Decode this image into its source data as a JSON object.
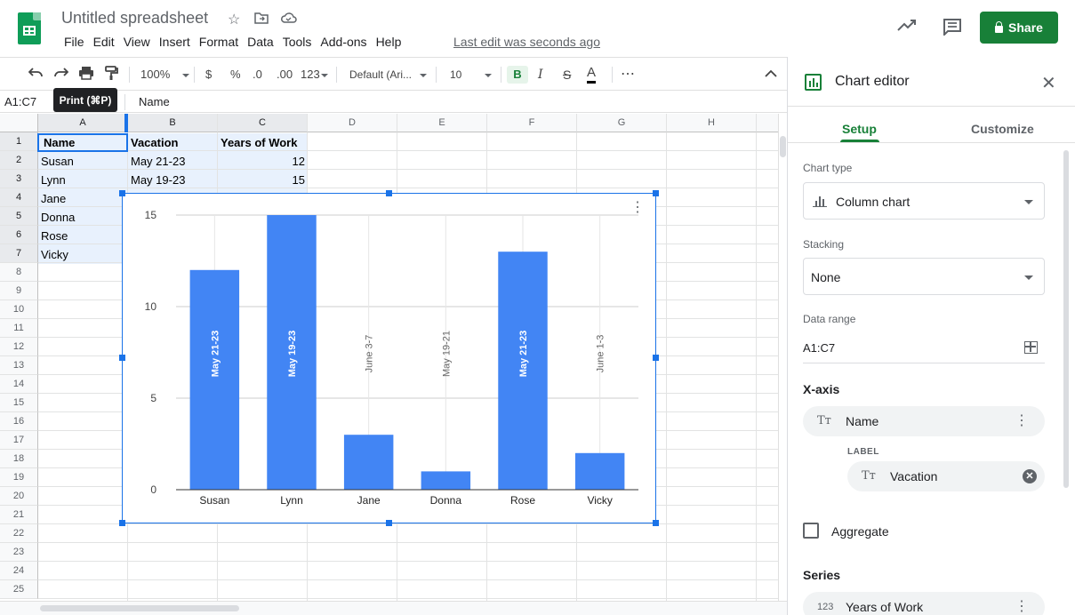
{
  "app": {
    "title": "Untitled spreadsheet",
    "menu": [
      "File",
      "Edit",
      "View",
      "Insert",
      "Format",
      "Data",
      "Tools",
      "Add-ons",
      "Help"
    ],
    "last_edit": "Last edit was seconds ago",
    "share_label": "Share",
    "accent_color": "#188038"
  },
  "toolbar": {
    "zoom": "100%",
    "currency": "$",
    "percent": "%",
    "dec_less": ".0",
    "dec_more": ".00",
    "format_more": "123",
    "font": "Default (Ari...",
    "font_size": "10",
    "bold": "B",
    "italic": "I",
    "strike": "S",
    "text_color": "A",
    "more": "⋯",
    "tooltip": "Print (⌘P)"
  },
  "formula": {
    "name_box": "A1:C7",
    "value": "Name"
  },
  "grid": {
    "columns": [
      "A",
      "B",
      "C",
      "D",
      "E",
      "F",
      "G",
      "H"
    ],
    "rows": [
      "1",
      "2",
      "3",
      "4",
      "5",
      "6",
      "7",
      "8",
      "9",
      "10",
      "11",
      "12",
      "13",
      "14",
      "15",
      "16",
      "17",
      "18",
      "19",
      "20",
      "21",
      "22",
      "23",
      "24",
      "25"
    ],
    "header": [
      "Name",
      "Vacation",
      "Years of Work"
    ],
    "data": [
      [
        "Susan",
        "May 21-23",
        "12"
      ],
      [
        "Lynn",
        "May 19-23",
        "15"
      ],
      [
        "Jane",
        "",
        ""
      ],
      [
        "Donna",
        "",
        ""
      ],
      [
        "Rose",
        "",
        ""
      ],
      [
        "Vicky",
        "",
        ""
      ]
    ]
  },
  "chart_data": {
    "type": "bar",
    "categories": [
      "Susan",
      "Lynn",
      "Jane",
      "Donna",
      "Rose",
      "Vicky"
    ],
    "series": [
      {
        "values": [
          12,
          15,
          3,
          1,
          13,
          2
        ],
        "labels": [
          "May 21-23",
          "May 19-23",
          "June 3-7",
          "May 19-21",
          "May 21-23",
          "June 1-3"
        ]
      }
    ],
    "ylim": [
      0,
      15
    ],
    "yticks": [
      0,
      5,
      10,
      15
    ],
    "grid": true,
    "color": "#4285f4"
  },
  "editor": {
    "title": "Chart editor",
    "tabs": [
      "Setup",
      "Customize"
    ],
    "chart_type_label": "Chart type",
    "chart_type": "Column chart",
    "stacking_label": "Stacking",
    "stacking": "None",
    "data_range_label": "Data range",
    "data_range": "A1:C7",
    "xaxis_label": "X-axis",
    "xaxis_value": "Name",
    "label_caption": "LABEL",
    "label_value": "Vacation",
    "aggregate_label": "Aggregate",
    "series_label": "Series",
    "series_value": "Years of Work",
    "text_type_icon": "Tт",
    "number_type_icon": "123"
  }
}
